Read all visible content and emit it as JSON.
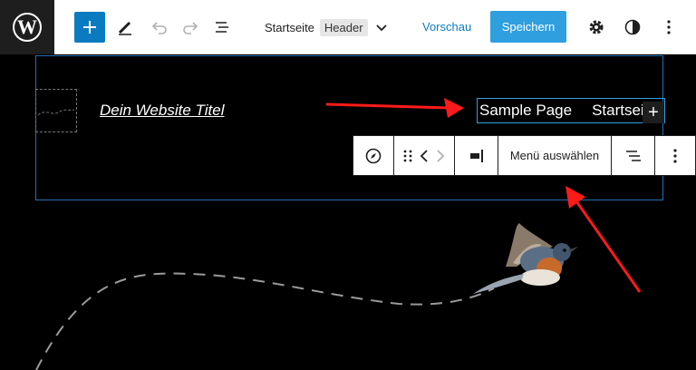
{
  "topbar": {
    "logo_icon": "wordpress-logo-icon",
    "add_icon": "plus-icon",
    "tools_icon": "pencil-icon",
    "undo_icon": "undo-icon",
    "redo_icon": "redo-icon",
    "list_view_icon": "list-view-icon",
    "document_title": "Startseite",
    "document_tag": "Header",
    "preview_label": "Vorschau",
    "save_label": "Speichern",
    "settings_icon": "gear-icon",
    "styles_icon": "contrast-icon",
    "options_icon": "more-vertical-icon",
    "colors": {
      "accent": "#2f9fe0",
      "primary_button": "#0a7bc1"
    }
  },
  "canvas": {
    "site_title": "Dein Website Titel",
    "navigation_items": [
      "Sample Page",
      "Startseite"
    ],
    "nav_add_label": "+",
    "background": "#000000",
    "selection_color": "#2271b1"
  },
  "block_toolbar": {
    "block_icon": "compass-icon",
    "drag_icon": "drag-handle-icon",
    "move_left_icon": "chevron-left-icon",
    "move_right_icon": "chevron-right-icon",
    "justify_icon": "justify-right-icon",
    "menu_select_label": "Menü auswählen",
    "align_icon": "align-icon",
    "more_icon": "more-vertical-icon"
  }
}
